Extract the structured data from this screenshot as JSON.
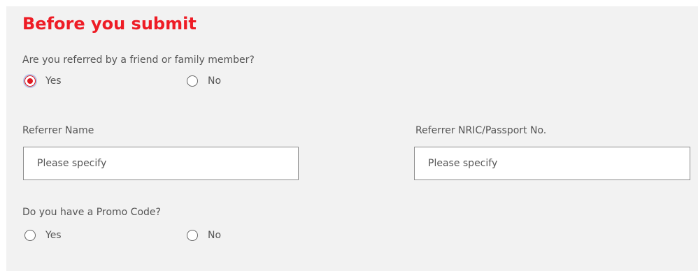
{
  "form": {
    "title": "Before you submit",
    "accent_color": "#ee1c25",
    "referral": {
      "question": "Are you referred by a friend or family member?",
      "options": [
        {
          "label": "Yes",
          "selected": true
        },
        {
          "label": "No",
          "selected": false
        }
      ]
    },
    "referrer_name": {
      "label": "Referrer Name",
      "placeholder": "Please specify",
      "value": ""
    },
    "referrer_id": {
      "label": "Referrer NRIC/Passport No.",
      "placeholder": "Please specify",
      "value": ""
    },
    "promo": {
      "question": "Do you have a Promo Code?",
      "options": [
        {
          "label": "Yes",
          "selected": false
        },
        {
          "label": "No",
          "selected": false
        }
      ]
    }
  }
}
